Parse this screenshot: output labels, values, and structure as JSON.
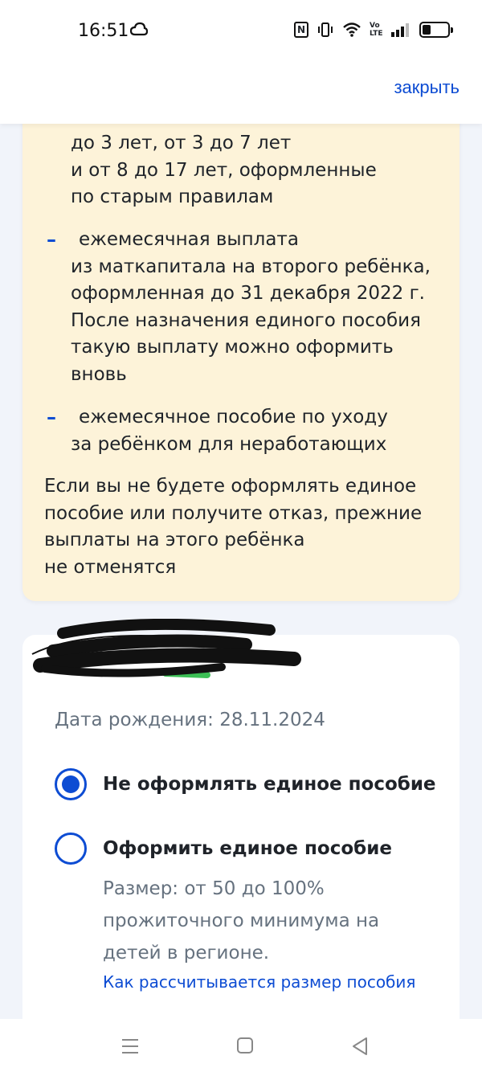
{
  "status_bar": {
    "time": "16:51",
    "icons": [
      "cloud-icon",
      "nfc-icon",
      "vibrate-icon",
      "wifi-icon",
      "volte-icon",
      "signal-icon",
      "battery-icon"
    ],
    "volte_text": "Vo LTE",
    "nfc_text": "N"
  },
  "header": {
    "close_label": "закрыть"
  },
  "info": {
    "item1_lines": [
      "до 3 лет, от 3 до 7 лет",
      "и от 8 до 17 лет, оформленные",
      "по старым правилам"
    ],
    "dash": "–",
    "item2_lines": [
      "ежемесячная выплата",
      "из маткапитала на второго ребёнка,",
      "оформленная до 31 декабря 2022 г.",
      "После назначения единого пособия",
      "такую выплату можно оформить",
      "вновь"
    ],
    "item3_lines": [
      "ежемесячное пособие по уходу",
      "за ребёнком для неработающих"
    ],
    "note_lines": [
      "Если вы не будете оформлять единое",
      "пособие или получите отказ, прежние",
      "выплаты на этого ребёнка",
      "не отменятся"
    ]
  },
  "child": {
    "birth_date": "Дата рождения: 28.11.2024",
    "option1_label": "Не оформлять единое пособие",
    "option1_selected": true,
    "option2_label": "Оформить единое пособие",
    "option2_selected": false,
    "option2_desc_lines": [
      "Размер: от 50 до 100%",
      "прожиточного минимума на",
      "детей в регионе."
    ],
    "option2_link": "Как рассчитывается размер пособия"
  },
  "colors": {
    "accent": "#0d4cd3",
    "info_bg": "#fdf3d9",
    "page_bg": "#f1f4fa",
    "muted_text": "#66727f"
  },
  "nav": {
    "buttons": [
      "menu-icon",
      "home-icon",
      "back-icon"
    ]
  }
}
